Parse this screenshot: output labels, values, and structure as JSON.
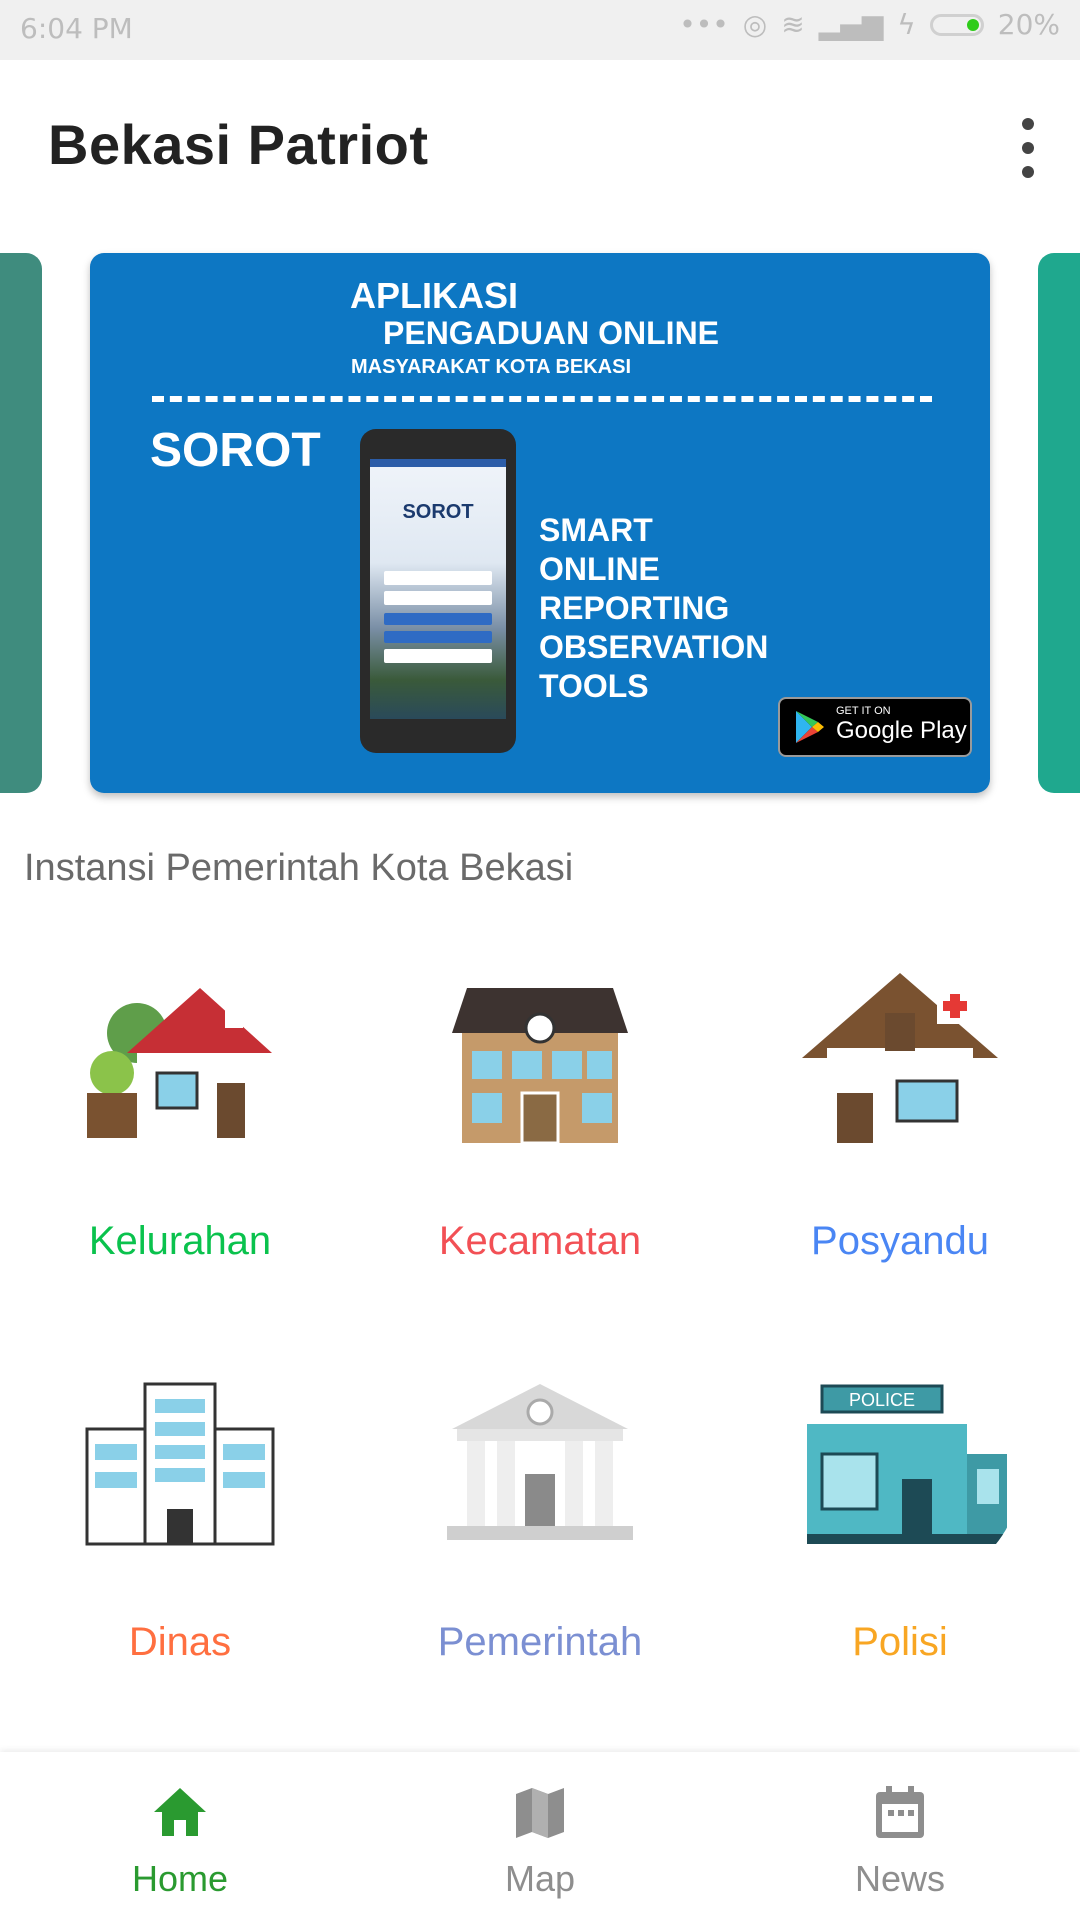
{
  "status_bar": {
    "time": "6:04 PM",
    "battery": "20%",
    "battery_level": 0.2
  },
  "app_bar": {
    "title": "Bekasi Patriot"
  },
  "banner": {
    "line1": "APLIKASI",
    "line2": "PENGADUAN ONLINE",
    "line3": "MASYARAKAT KOTA BEKASI",
    "brand": "SOROT",
    "phone_logo": "SOROT",
    "tagline": [
      "SMART",
      "ONLINE",
      "REPORTING",
      "OBSERVATION",
      "TOOLS"
    ],
    "store_small": "GET IT ON",
    "store_big": "Google Play"
  },
  "section_title": "Instansi Pemerintah Kota Bekasi",
  "categories": [
    {
      "label": "Kelurahan",
      "color": "#0ac24d",
      "icon": "house-icon"
    },
    {
      "label": "Kecamatan",
      "color": "#f25055",
      "icon": "district-office-icon"
    },
    {
      "label": "Posyandu",
      "color": "#4a86f4",
      "icon": "health-post-icon"
    },
    {
      "label": "Dinas",
      "color": "#ff6f40",
      "icon": "office-building-icon"
    },
    {
      "label": "Pemerintah",
      "color": "#7b8fd2",
      "icon": "government-building-icon"
    },
    {
      "label": "Polisi",
      "color": "#f8a623",
      "icon": "police-station-icon"
    }
  ],
  "police_sign": "POLICE",
  "bottom_nav": {
    "items": [
      {
        "label": "Home",
        "icon": "home-icon",
        "active": true
      },
      {
        "label": "Map",
        "icon": "map-icon",
        "active": false
      },
      {
        "label": "News",
        "icon": "calendar-icon",
        "active": false
      }
    ],
    "active_color": "#2a9a30",
    "inactive_color": "#8e8e8e"
  }
}
